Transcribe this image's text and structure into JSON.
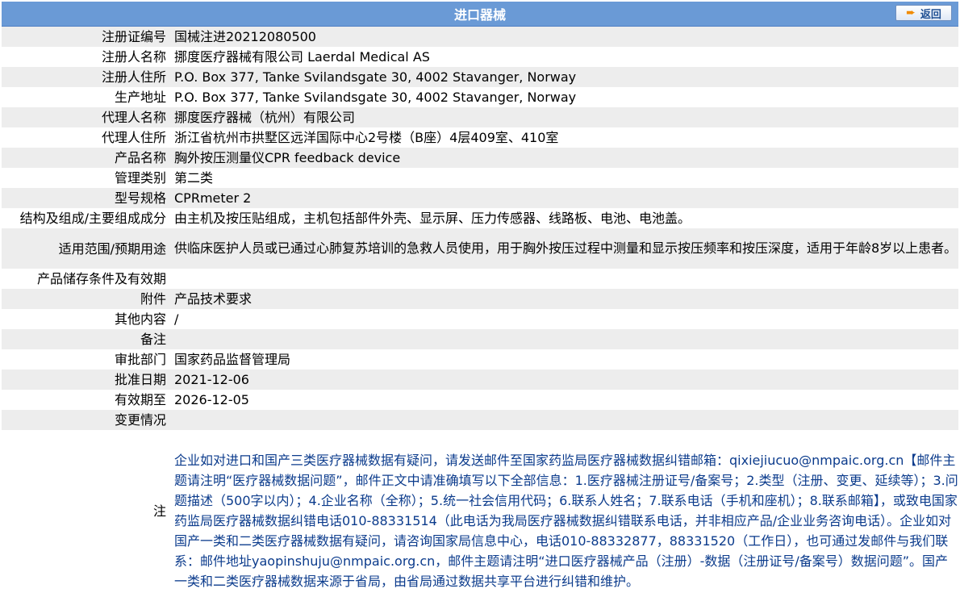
{
  "header": {
    "title": "进口器械",
    "back_label": "返回",
    "colors": {
      "bar": "#6a9ad6",
      "row_alt": "#ededed",
      "note_text": "#0b3b8c"
    }
  },
  "rows": [
    {
      "label": "注册证编号",
      "value": "国械注进20212080500"
    },
    {
      "label": "注册人名称",
      "value": "挪度医疗器械有限公司 Laerdal Medical AS"
    },
    {
      "label": "注册人住所",
      "value": "P.O. Box 377, Tanke Svilandsgate 30, 4002 Stavanger, Norway"
    },
    {
      "label": "生产地址",
      "value": "P.O. Box 377, Tanke Svilandsgate 30, 4002 Stavanger, Norway"
    },
    {
      "label": "代理人名称",
      "value": "挪度医疗器械（杭州）有限公司"
    },
    {
      "label": "代理人住所",
      "value": "浙江省杭州市拱墅区远洋国际中心2号楼（B座）4层409室、410室"
    },
    {
      "label": "产品名称",
      "value": "胸外按压测量仪CPR feedback device"
    },
    {
      "label": "管理类别",
      "value": "第二类"
    },
    {
      "label": "型号规格",
      "value": "CPRmeter 2"
    },
    {
      "label": "结构及组成/主要组成成分",
      "value": "由主机及按压贴组成，主机包括部件外壳、显示屏、压力传感器、线路板、电池、电池盖。"
    },
    {
      "label": "适用范围/预期用途",
      "value": "供临床医护人员或已通过心肺复苏培训的急救人员使用，用于胸外按压过程中测量和显示按压频率和按压深度，适用于年龄8岁以上患者。"
    },
    {
      "label": "产品储存条件及有效期",
      "value": ""
    },
    {
      "label": "附件",
      "value": "产品技术要求"
    },
    {
      "label": "其他内容",
      "value": "/"
    },
    {
      "label": "备注",
      "value": ""
    },
    {
      "label": "审批部门",
      "value": "国家药品监督管理局"
    },
    {
      "label": "批准日期",
      "value": "2021-12-06"
    },
    {
      "label": "有效期至",
      "value": "2026-12-05"
    },
    {
      "label": "变更情况",
      "value": ""
    }
  ],
  "note": {
    "label": "注",
    "text": "企业如对进口和国产三类医疗器械数据有疑问，请发送邮件至国家药监局医疗器械数据纠错邮箱：qixiejiucuo@nmpaic.org.cn【邮件主题请注明“医疗器械数据问题”，邮件正文中请准确填写以下全部信息：1.医疗器械注册证号/备案号；2.类型（注册、变更、延续等）；3.问题描述（500字以内）；4.企业名称（全称）；5.统一社会信用代码；6.联系人姓名；7.联系电话（手机和座机）；8.联系邮箱】，或致电国家药监局医疗器械数据纠错电话010-88331514（此电话为我局医疗器械数据纠错联系电话，并非相应产品/企业业务咨询电话）。企业如对国产一类和二类医疗器械数据有疑问，请咨询国家局信息中心，电话010-88332877，88331520（工作日），也可通过发邮件与我们联系：邮件地址yaopinshuju@nmpaic.org.cn，邮件主题请注明“进口医疗器械产品（注册）-数据（注册证号/备案号）数据问题”。国产一类和二类医疗器械数据来源于省局，由省局通过数据共享平台进行纠错和维护。"
  }
}
